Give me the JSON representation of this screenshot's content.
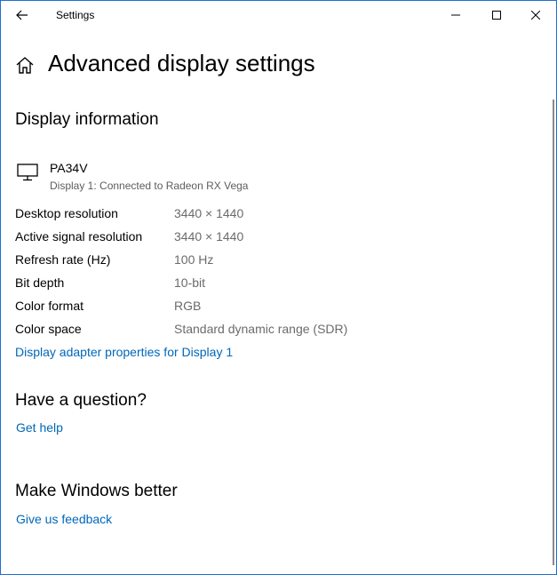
{
  "window": {
    "app_title": "Settings",
    "accent_border": "#1f6fd0"
  },
  "header": {
    "title": "Advanced display settings",
    "home_icon": "home-icon"
  },
  "display_info": {
    "heading": "Display information",
    "monitor": {
      "name": "PA34V",
      "subtitle": "Display 1: Connected to Radeon RX Vega",
      "icon": "monitor-icon"
    },
    "rows": [
      {
        "label": "Desktop resolution",
        "value": "3440 × 1440"
      },
      {
        "label": "Active signal resolution",
        "value": "3440 × 1440"
      },
      {
        "label": "Refresh rate (Hz)",
        "value": "100 Hz"
      },
      {
        "label": "Bit depth",
        "value": "10-bit"
      },
      {
        "label": "Color format",
        "value": "RGB"
      },
      {
        "label": "Color space",
        "value": "Standard dynamic range (SDR)"
      }
    ],
    "adapter_link": "Display adapter properties for Display 1"
  },
  "question": {
    "heading": "Have a question?",
    "link": "Get help"
  },
  "better": {
    "heading": "Make Windows better",
    "link": "Give us feedback"
  },
  "colors": {
    "link": "#0067b8",
    "secondary_text": "#6b6b6b"
  }
}
